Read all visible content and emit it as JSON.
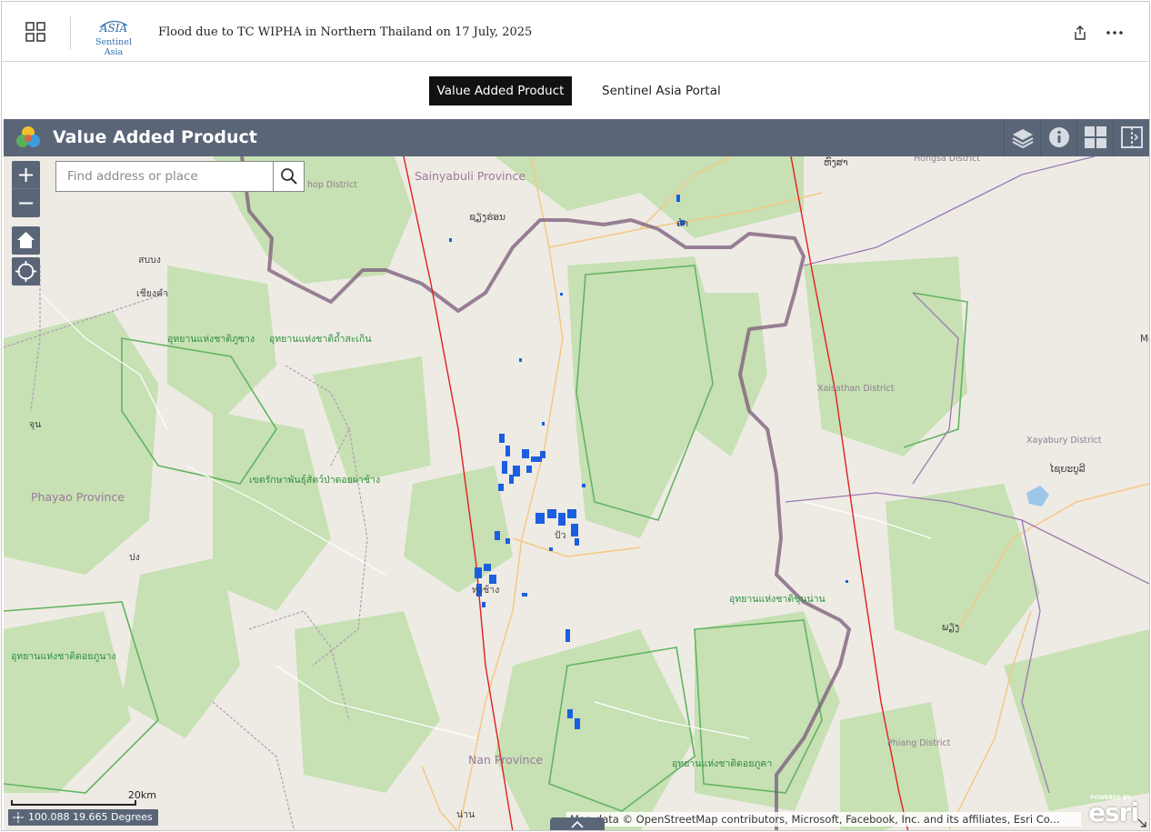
{
  "header": {
    "title": "Flood due to TC WIPHA in Northern Thailand on 17 July, 2025",
    "logo_text": "Sentinel Asia",
    "logo_mark": "ASIA"
  },
  "tabs": [
    {
      "label": "Value Added Product",
      "active": true
    },
    {
      "label": "Sentinel Asia Portal",
      "active": false
    }
  ],
  "map_widget": {
    "title": "Value Added Product",
    "header_buttons": [
      "layers-icon",
      "info-icon",
      "basemap-gallery-icon",
      "swipe-icon"
    ]
  },
  "search": {
    "placeholder": "Find address or place",
    "value": ""
  },
  "zoom": {
    "in": "+",
    "out": "−"
  },
  "labels": {
    "sainyabuli": "Sainyabuli Province",
    "phayao": "Phayao Province",
    "nan": "Nan Province",
    "xaisathan": "Xaisathan District",
    "xayabury": "Xayabury District",
    "phiang": "Phiang District",
    "hongsa": "Hongsa District",
    "hop": "hop District",
    "park1": "อุทยานแห่งชาติภูซาง",
    "park2": "อุทยานแห่งชาติถ้ำสะเกิน",
    "park3": "เขตรักษาพันธุ์สัตว์ป่าดอยผาช้าง",
    "park4": "อุทยานแห่งชาติดอยภูนาง",
    "park5": "อุทยานแห่งชาติขุนน่าน",
    "park6": "อุทยานแห่งชาติดอยภูคา",
    "town1": "สบบง",
    "town2": "เชียงคำ",
    "town3": "จุน",
    "town4": "ปง",
    "town5": "ຊຽງຮ່ອນ",
    "town6": "ຄຳ",
    "town7": "ຫົງສາ",
    "town8": "ໄຊຍະບູລີ",
    "town9": "ພຽງ",
    "town10": "น่าน",
    "town11": "ทุ่งช้าง",
    "town12": "ปัว",
    "town13": "Me"
  },
  "scale": {
    "label": "20km"
  },
  "coords": {
    "text": "100.088 19.665 Degrees"
  },
  "attribution": "Map data © OpenStreetMap contributors, Microsoft, Facebook, Inc. and its affiliates, Esri Co...",
  "esri": {
    "powered": "POWERED BY",
    "brand": "esri"
  },
  "colors": {
    "header_bg": "#5a6678",
    "flood": "#1a5fe0",
    "border": "#7a5a7a",
    "red_line": "#e02020",
    "park_fill": "#c7e0b4",
    "land": "#eeebe4"
  }
}
